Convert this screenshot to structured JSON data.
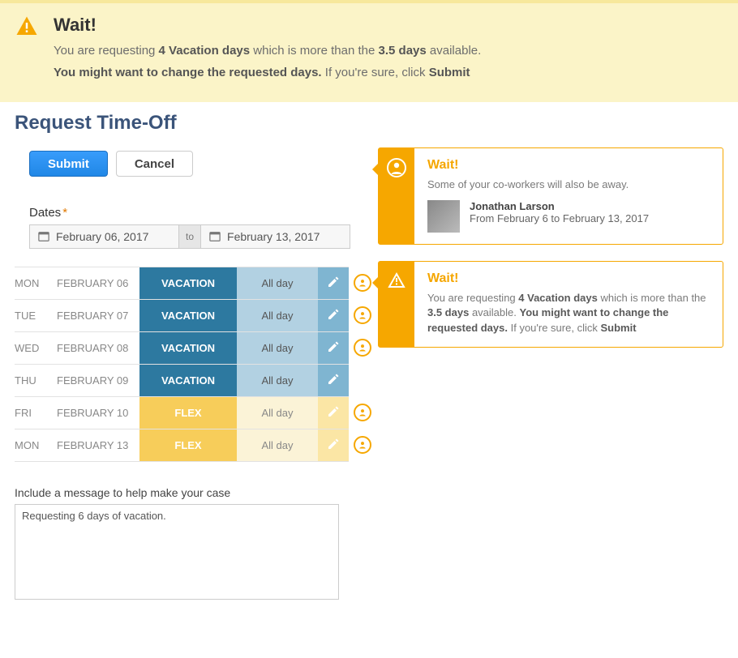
{
  "banner": {
    "title": "Wait!",
    "line1_prefix": "You are requesting ",
    "line1_bold1": "4 Vacation days",
    "line1_mid": " which is more than the ",
    "line1_bold2": "3.5 days",
    "line1_suffix": " available.",
    "line2_bold": "You might want to change the requested days.",
    "line2_mid": " If you're sure, click ",
    "line2_bold2": "Submit"
  },
  "page": {
    "title": "Request Time-Off"
  },
  "actions": {
    "submit": "Submit",
    "cancel": "Cancel"
  },
  "dates": {
    "label": "Dates",
    "required": "*",
    "from": "February 06, 2017",
    "to_label": "to",
    "to": "February 13, 2017"
  },
  "rows": [
    {
      "dow": "MON",
      "date": "FEBRUARY 06",
      "type": "VACATION",
      "dur": "All day",
      "kind": "vac"
    },
    {
      "dow": "TUE",
      "date": "FEBRUARY 07",
      "type": "VACATION",
      "dur": "All day",
      "kind": "vac"
    },
    {
      "dow": "WED",
      "date": "FEBRUARY 08",
      "type": "VACATION",
      "dur": "All day",
      "kind": "vac"
    },
    {
      "dow": "THU",
      "date": "FEBRUARY 09",
      "type": "VACATION",
      "dur": "All day",
      "kind": "vac"
    },
    {
      "dow": "FRI",
      "date": "FEBRUARY 10",
      "type": "FLEX",
      "dur": "All day",
      "kind": "flex"
    },
    {
      "dow": "MON",
      "date": "FEBRUARY 13",
      "type": "FLEX",
      "dur": "All day",
      "kind": "flex"
    }
  ],
  "indicators": [
    "person",
    "person",
    "person",
    "warning",
    "person",
    "person"
  ],
  "callout1": {
    "title": "Wait!",
    "sub": "Some of your co-workers will also be away.",
    "name": "Jonathan Larson",
    "range": "From February 6 to February 13, 2017"
  },
  "callout2": {
    "title": "Wait!",
    "t1": "You are requesting ",
    "b1": "4 Vacation days",
    "t2": " which is more than the ",
    "b2": "3.5 days",
    "t3": " available. ",
    "b3": "You might want to change the requested days.",
    "t4": " If you're sure, click ",
    "b4": "Submit"
  },
  "message": {
    "label": "Include a message to help make your case",
    "value": "Requesting 6 days of vacation."
  }
}
